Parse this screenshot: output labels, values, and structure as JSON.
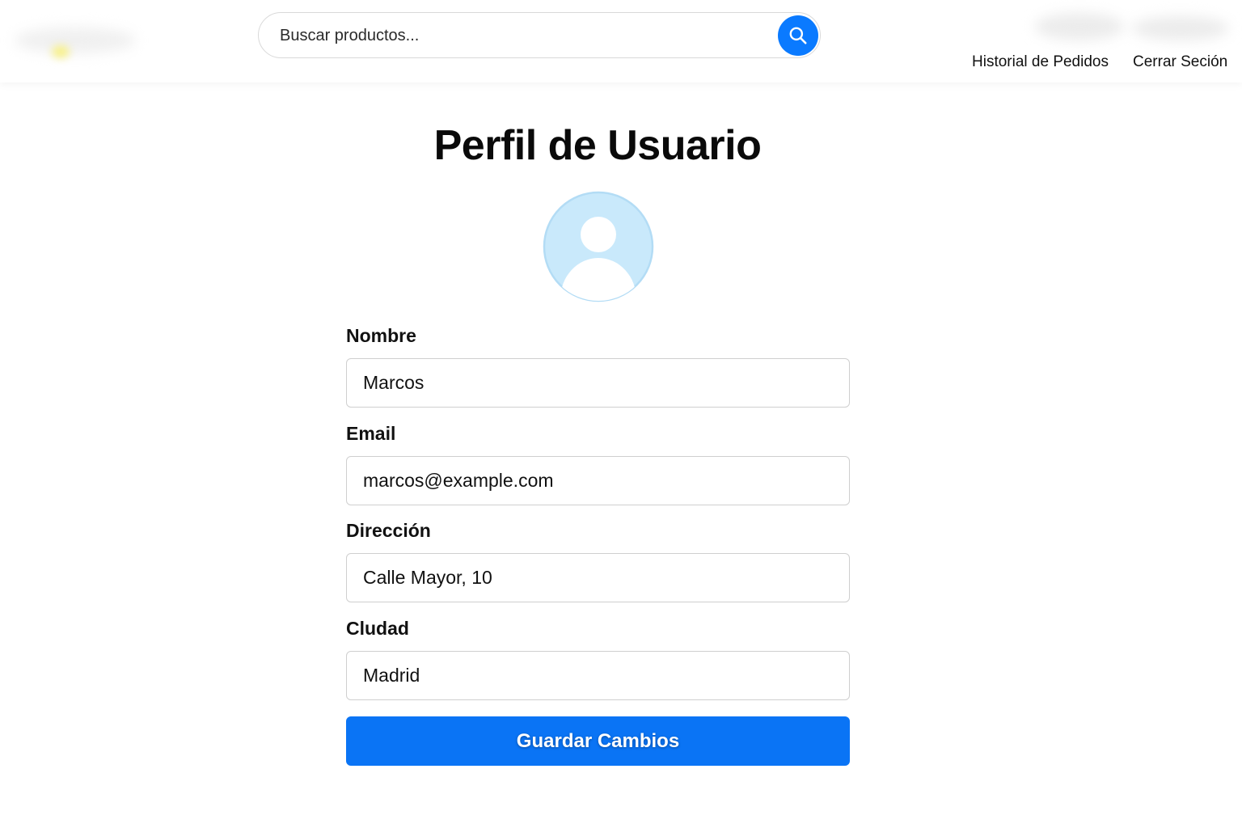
{
  "header": {
    "search": {
      "placeholder": "Buscar productos...",
      "icon": "search-icon"
    },
    "nav": {
      "order_history": "Historial de Pedidos",
      "logout": "Cerrar Seción"
    }
  },
  "main": {
    "title": "Perfil de Usuario",
    "avatar_icon": "user-avatar-icon",
    "fields": {
      "name": {
        "label": "Nombre",
        "value": "Marcos"
      },
      "email": {
        "label": "Email",
        "value": "marcos@example.com"
      },
      "address": {
        "label": "Dirección",
        "value": "Calle Mayor, 10"
      },
      "city": {
        "label": "Cludad",
        "value": "Madrid"
      }
    },
    "save_label": "Guardar Cambios"
  },
  "colors": {
    "accent": "#0a74f5",
    "avatar_bg": "#c9e9fb",
    "avatar_border": "#b3dcf5"
  }
}
